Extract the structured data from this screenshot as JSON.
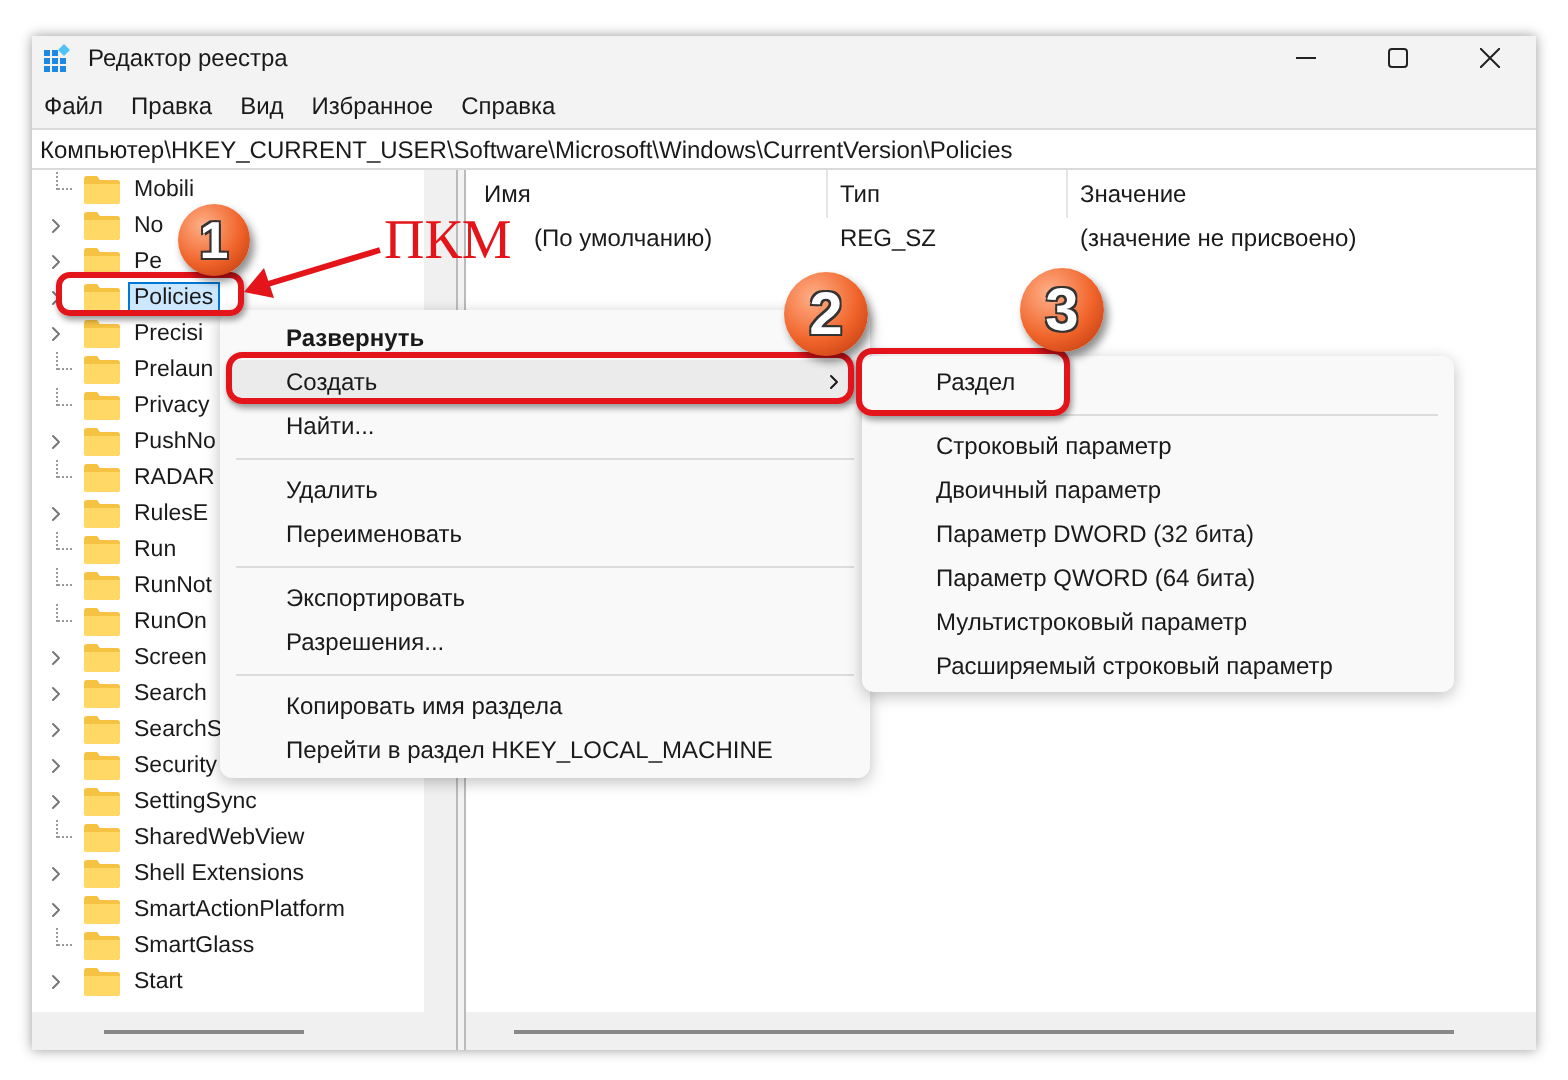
{
  "window": {
    "title": "Редактор реестра"
  },
  "menu_bar": [
    "Файл",
    "Правка",
    "Вид",
    "Избранное",
    "Справка"
  ],
  "address_bar": "Компьютер\\HKEY_CURRENT_USER\\Software\\Microsoft\\Windows\\CurrentVersion\\Policies",
  "tree": {
    "items": [
      {
        "label": "Mobili",
        "expandable": false,
        "selected": false
      },
      {
        "label": "No",
        "expandable": true,
        "selected": false
      },
      {
        "label": "Pe",
        "expandable": true,
        "selected": false
      },
      {
        "label": "Policies",
        "expandable": true,
        "selected": true
      },
      {
        "label": "Precisi",
        "expandable": true,
        "selected": false
      },
      {
        "label": "Prelaun",
        "expandable": false,
        "selected": false
      },
      {
        "label": "Privacy",
        "expandable": false,
        "selected": false
      },
      {
        "label": "PushNo",
        "expandable": true,
        "selected": false
      },
      {
        "label": "RADAR",
        "expandable": false,
        "selected": false
      },
      {
        "label": "RulesE",
        "expandable": true,
        "selected": false
      },
      {
        "label": "Run",
        "expandable": false,
        "selected": false
      },
      {
        "label": "RunNot",
        "expandable": false,
        "selected": false
      },
      {
        "label": "RunOn",
        "expandable": false,
        "selected": false
      },
      {
        "label": "Screen",
        "expandable": true,
        "selected": false
      },
      {
        "label": "Search",
        "expandable": true,
        "selected": false
      },
      {
        "label": "SearchS",
        "expandable": true,
        "selected": false
      },
      {
        "label": "Security",
        "expandable": true,
        "selected": false
      },
      {
        "label": "SettingSync",
        "expandable": true,
        "selected": false
      },
      {
        "label": "SharedWebView",
        "expandable": false,
        "selected": false
      },
      {
        "label": "Shell Extensions",
        "expandable": true,
        "selected": false
      },
      {
        "label": "SmartActionPlatform",
        "expandable": true,
        "selected": false
      },
      {
        "label": "SmartGlass",
        "expandable": false,
        "selected": false
      },
      {
        "label": "Start",
        "expandable": true,
        "selected": false
      }
    ]
  },
  "list": {
    "columns": [
      "Имя",
      "Тип",
      "Значение"
    ],
    "rows": [
      {
        "name": "(По умолчанию)",
        "type": "REG_SZ",
        "value": "(значение не присвоено)"
      }
    ]
  },
  "context_menu": {
    "items": [
      {
        "kind": "item",
        "label": "Развернуть",
        "bold": true,
        "selected": false,
        "submenu": false
      },
      {
        "kind": "item",
        "label": "Создать",
        "bold": false,
        "selected": true,
        "submenu": true
      },
      {
        "kind": "item",
        "label": "Найти...",
        "bold": false,
        "selected": false,
        "submenu": false
      },
      {
        "kind": "separator"
      },
      {
        "kind": "item",
        "label": "Удалить",
        "bold": false,
        "selected": false,
        "submenu": false
      },
      {
        "kind": "item",
        "label": "Переименовать",
        "bold": false,
        "selected": false,
        "submenu": false
      },
      {
        "kind": "separator"
      },
      {
        "kind": "item",
        "label": "Экспортировать",
        "bold": false,
        "selected": false,
        "submenu": false
      },
      {
        "kind": "item",
        "label": "Разрешения...",
        "bold": false,
        "selected": false,
        "submenu": false
      },
      {
        "kind": "separator"
      },
      {
        "kind": "item",
        "label": "Копировать имя раздела",
        "bold": false,
        "selected": false,
        "submenu": false
      },
      {
        "kind": "item",
        "label": "Перейти в раздел HKEY_LOCAL_MACHINE",
        "bold": false,
        "selected": false,
        "submenu": false
      }
    ]
  },
  "submenu": {
    "items": [
      {
        "kind": "item",
        "label": "Раздел"
      },
      {
        "kind": "separator"
      },
      {
        "kind": "item",
        "label": "Строковый параметр"
      },
      {
        "kind": "item",
        "label": "Двоичный параметр"
      },
      {
        "kind": "item",
        "label": "Параметр DWORD (32 бита)"
      },
      {
        "kind": "item",
        "label": "Параметр QWORD (64 бита)"
      },
      {
        "kind": "item",
        "label": "Мультистроковый параметр"
      },
      {
        "kind": "item",
        "label": "Расширяемый строковый параметр"
      }
    ]
  },
  "annotations": {
    "markers": [
      "1",
      "2",
      "3"
    ],
    "caption": "ПКМ"
  }
}
